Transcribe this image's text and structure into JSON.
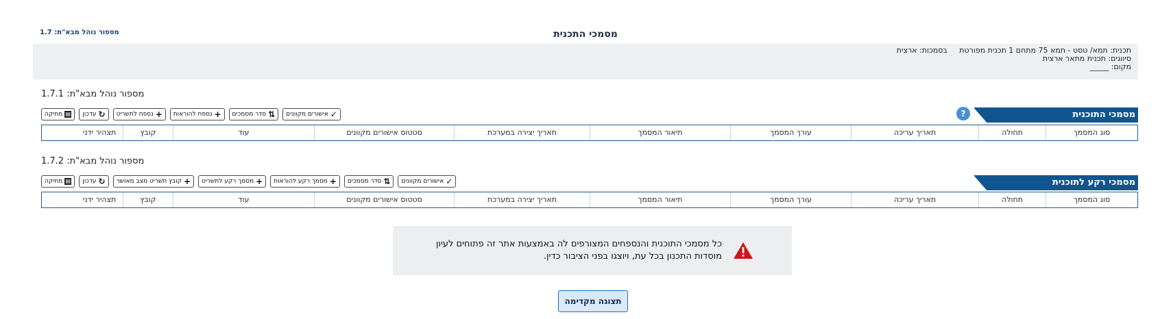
{
  "header": {
    "title": "מסמכי התכנית",
    "admin_number": "מספור נוהל מבא\"ת: 1.7"
  },
  "plan_info": {
    "plan_name": "תכנית: תמא/ טסט - תמא 75 מתחם 1 תכנית מפורטת",
    "authority": "בסמכות: ארצית",
    "classification": "סיווגים: תכנית מתאר ארצית",
    "location": "מקום: _____"
  },
  "columns": {
    "doc_type": "סוג המסמך",
    "validity": "תחולה",
    "edit_date": "תאריך עריכה",
    "editor": "עורך המסמך",
    "description": "תיאור המסמך",
    "creation_date": "תאריך יצירה במערכת",
    "approval_status": "סטטוס אישורים מקוונים",
    "more": "עוד",
    "file": "קובץ",
    "manual_declaration": "תצהיר ידני"
  },
  "section1": {
    "admin_number": "מספור נוהל מבא\"ת: 1.7.1",
    "ribbon_title": "מסמכי התוכנית",
    "help_icon": "?",
    "toolbar": {
      "online_approvals": "אישורים מקוונים",
      "order_docs": "סדר מסמכים",
      "appendix_instructions": "נספח להוראות",
      "appendix_drawing": "נספח לתשריט",
      "update": "עדכון",
      "delete": "מחיקה"
    }
  },
  "section2": {
    "admin_number": "מספור נוהל מבא\"ת: 1.7.2",
    "ribbon_title": "מסמכי רקע לתוכנית",
    "toolbar": {
      "online_approvals": "אישורים מקוונים",
      "order_docs": "סדר מסמכים",
      "bg_instructions": "מסמך רקע להוראות",
      "bg_drawing": "מסמך רקע לתשריט",
      "approved_state_file": "קובץ תשריט מצב מאושר",
      "update": "עדכון",
      "delete": "מחיקה"
    }
  },
  "notice": {
    "line1": "כל מסמכי התוכנית והנספחים המצורפים לה באמצעות אתר זה פתוחים לעיון",
    "line2": "מוסדות התכנון בכל עת, ויוצגו בפני הציבור כדין."
  },
  "preview_button": "תצוגה מקדימה",
  "colors": {
    "ribbon": "#11558f",
    "grid_border": "#1a5d95",
    "warning": "#d4121b",
    "help_icon": "#4a8fd6",
    "preview_bg": "#d9e9f7"
  }
}
